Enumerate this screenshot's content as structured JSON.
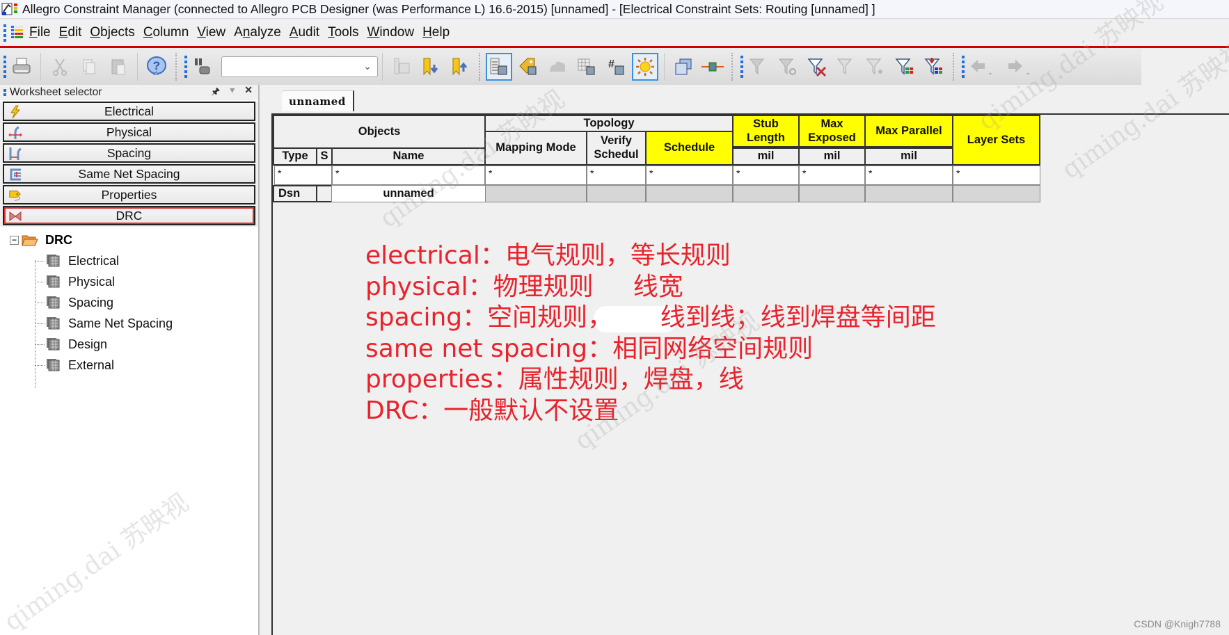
{
  "window": {
    "title": "Allegro Constraint Manager (connected to Allegro PCB Designer (was Performance L) 16.6-2015) [unnamed] - [Electrical Constraint Sets:  Routing [unnamed] ]"
  },
  "menu": {
    "items": [
      {
        "label": "File",
        "accel": "F"
      },
      {
        "label": "Edit",
        "accel": "E"
      },
      {
        "label": "Objects",
        "accel": "O"
      },
      {
        "label": "Column",
        "accel": "C"
      },
      {
        "label": "View",
        "accel": "V"
      },
      {
        "label": "Analyze",
        "accel": "n"
      },
      {
        "label": "Audit",
        "accel": "A"
      },
      {
        "label": "Tools",
        "accel": "T"
      },
      {
        "label": "Window",
        "accel": "W"
      },
      {
        "label": "Help",
        "accel": "H"
      }
    ]
  },
  "toolbar": {
    "search_combo_value": "",
    "icons": [
      "print-icon",
      "cut-icon",
      "copy-icon",
      "paste-icon",
      "help-icon",
      "find-icon",
      "worksheet-icon",
      "bookmark-down-icon",
      "bookmark-up-icon",
      "column-panel-icon",
      "tag-icon",
      "cloud-icon",
      "grid-icon",
      "hash-icon",
      "sun-icon",
      "windows-icon",
      "connect-icon",
      "filter-refresh-icon",
      "filter-clear-icon",
      "filter-drc-icon",
      "filter-route-icon",
      "filter-settings-icon",
      "filter-table-icon",
      "filter-down-icon",
      "back-icon",
      "forward-icon"
    ]
  },
  "worksheet_selector": {
    "title": "Worksheet selector",
    "buttons": [
      {
        "label": "Electrical",
        "icon": "lightning-icon",
        "selected": false
      },
      {
        "label": "Physical",
        "icon": "physical-icon",
        "selected": false
      },
      {
        "label": "Spacing",
        "icon": "spacing-icon",
        "selected": false
      },
      {
        "label": "Same Net Spacing",
        "icon": "same-net-spacing-icon",
        "selected": false
      },
      {
        "label": "Properties",
        "icon": "tag-icon",
        "selected": false
      },
      {
        "label": "DRC",
        "icon": "bowtie-icon",
        "selected": true
      }
    ],
    "tree": {
      "root": "DRC",
      "children": [
        "Electrical",
        "Physical",
        "Spacing",
        "Same Net Spacing",
        "Design",
        "External"
      ]
    }
  },
  "workspace": {
    "tab_label": "unnamed",
    "table": {
      "groups": {
        "objects": "Objects",
        "topology": "Topology"
      },
      "headers": {
        "type": "Type",
        "s": "S",
        "name": "Name",
        "mapping_mode": "Mapping Mode",
        "verify_schedule": "Verify Schedul",
        "schedule": "Schedule",
        "stub_length": "Stub Length",
        "max_exposed": "Max Exposed",
        "max_parallel": "Max Parallel",
        "layer_sets": "Layer Sets"
      },
      "units": {
        "stub_length": "mil",
        "max_exposed": "mil",
        "max_parallel": "mil"
      },
      "filter": "*",
      "rows": [
        {
          "type": "Dsn",
          "s": "",
          "name": "unnamed"
        }
      ]
    }
  },
  "annotations": [
    "electrical：电气规则，等长规则",
    "physical：物理规则     线宽",
    "spacing：空间规则，      线到线；线到焊盘等间距",
    "same net spacing：相同网络空间规则",
    "properties：属性规则，焊盘，线",
    "DRC：一般默认不设置"
  ],
  "colors": {
    "annotation": "#e8232c",
    "highlight_yellow": "#ffff00",
    "menu_redline": "#d20000",
    "selected_outline": "#e03030"
  },
  "watermarks": [
    "qiming.dai 苏映视"
  ],
  "credit": "CSDN @Knigh7788"
}
